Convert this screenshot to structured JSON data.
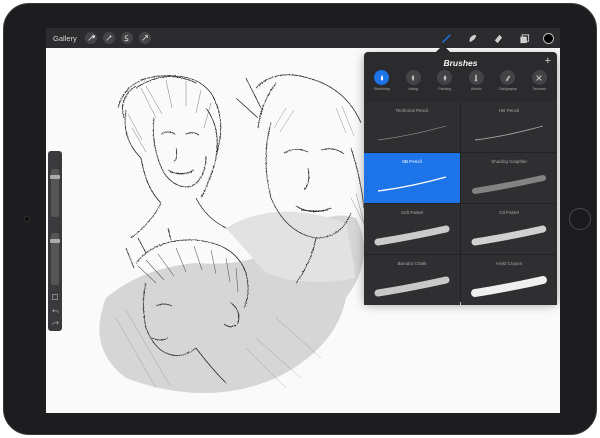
{
  "toolbar": {
    "gallery_label": "Gallery",
    "left_tools": [
      {
        "icon": "wrench-icon"
      },
      {
        "icon": "adjustments-wand-icon"
      },
      {
        "icon": "selection-icon"
      },
      {
        "icon": "transform-arrow-icon"
      }
    ],
    "right_tools": [
      {
        "icon": "brush-icon"
      },
      {
        "icon": "smudge-icon"
      },
      {
        "icon": "eraser-icon"
      },
      {
        "icon": "layers-icon"
      }
    ],
    "current_color": "#000000"
  },
  "brushes_panel": {
    "title": "Brushes",
    "add_symbol": "+",
    "categories": [
      {
        "label": "Sketching",
        "icon": "sketching-icon",
        "active": true
      },
      {
        "label": "Inking",
        "icon": "inking-icon",
        "active": false
      },
      {
        "label": "Painting",
        "icon": "painting-icon",
        "active": false
      },
      {
        "label": "Artistic",
        "icon": "artistic-icon",
        "active": false
      },
      {
        "label": "Calligraphy",
        "icon": "calligraphy-icon",
        "active": false
      },
      {
        "label": "Textures",
        "icon": "textures-icon",
        "active": false
      }
    ],
    "brushes": [
      {
        "name": "Technical Pencil",
        "selected": false
      },
      {
        "name": "HB Pencil",
        "selected": false
      },
      {
        "name": "6B Pencil",
        "selected": true
      },
      {
        "name": "Shading Graphite",
        "selected": false
      },
      {
        "name": "Soft Pastel",
        "selected": false
      },
      {
        "name": "Oil Pastel",
        "selected": false
      },
      {
        "name": "Bonobo Chalk",
        "selected": false
      },
      {
        "name": "Artist Crayon",
        "selected": false
      }
    ]
  },
  "colors": {
    "accent": "#1c74e8",
    "panel": "#2b2b2d",
    "toolbar": "#2c2c2e"
  }
}
